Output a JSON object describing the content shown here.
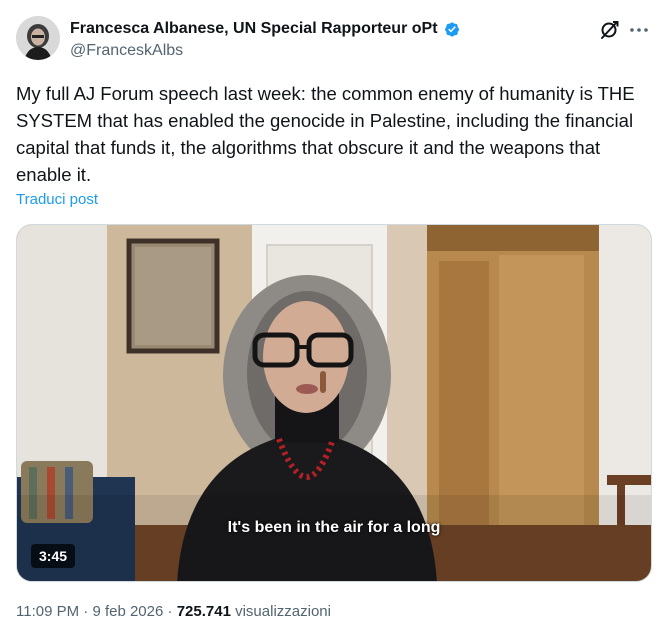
{
  "author": {
    "display_name": "Francesca Albanese, UN Special Rapporteur oPt",
    "handle": "@FranceskAlbs",
    "verified_icon": "verified-badge-icon",
    "accent_color": "#1d9bf0"
  },
  "actions": {
    "grok_icon": "grok-icon",
    "more_icon": "more-dots-icon"
  },
  "post": {
    "text": "My full AJ Forum speech last week: the common enemy of humanity is THE SYSTEM that has enabled the genocide in Palestine, including the financial capital that funds it, the algorithms that obscure it and the weapons that enable it.",
    "translate_label": "Traduci post"
  },
  "video": {
    "caption": "It's been in the air for a long",
    "duration": "3:45"
  },
  "meta": {
    "time": "11:09 PM",
    "separator": "·",
    "date": "9 feb 2026",
    "views_count": "725.741",
    "views_label": "visualizzazioni"
  }
}
